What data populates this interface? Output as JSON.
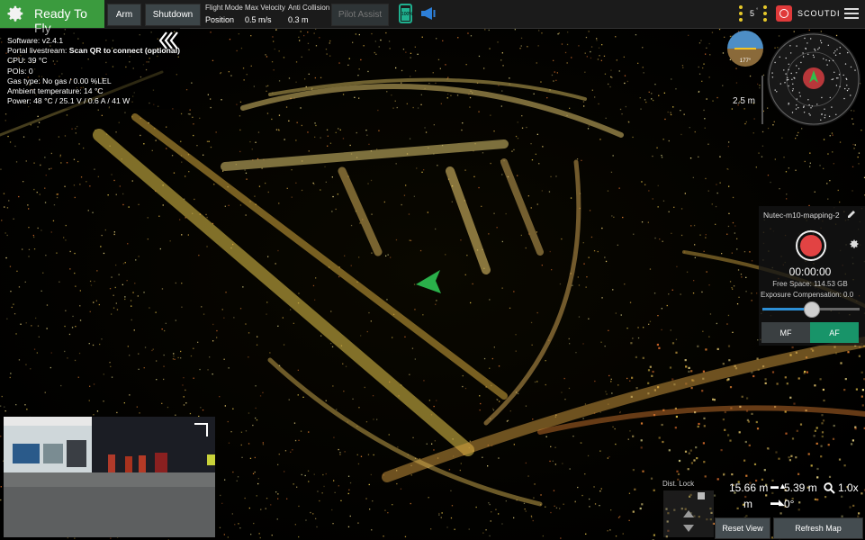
{
  "status": {
    "label": "Ready To Fly",
    "color": "#3b9b3e"
  },
  "toolbar": {
    "arm_label": "Arm",
    "shutdown_label": "Shutdown",
    "flight_mode_label": "Flight Mode",
    "flight_mode_value": "Position",
    "max_velocity_label": "Max Velocity",
    "max_velocity_value": "0.5 m/s",
    "anti_collision_label": "Anti Collision",
    "anti_collision_value": "0.3 m",
    "pilot_assist_label": "Pilot Assist",
    "battery_text": "100%",
    "satellites": "5",
    "brand": "SCOUTDI"
  },
  "telemetry": {
    "software": "Software: v2.4.1",
    "portal_label": "Portal livestream:",
    "portal_value": "Scan QR to connect (optional)",
    "cpu": "CPU: 39 °C",
    "pois": "POIs: 0",
    "gas": "Gas type: No gas / 0.00 %LEL",
    "ambient": "Ambient temperature: 14 °C",
    "power": "Power: 48 °C / 25.1 V / 0.6 A / 41 W"
  },
  "navigation": {
    "heading": "177°",
    "altitude": "2.5 m"
  },
  "recorder": {
    "session_name": "Nutec-m10-mapping-2",
    "timer": "00:00:00",
    "free_space": "Free Space: 114.53 GB",
    "exposure_label": "Exposure Compensation: 0.0",
    "exposure_fraction": 0.5,
    "mf_label": "MF",
    "af_label": "AF"
  },
  "stats": {
    "distance": "15.66 m",
    "altitude": "5.39 m",
    "zoom": "1.0x",
    "unit": "m",
    "angle": "0°",
    "dist_lock_label": "Dist. Lock"
  },
  "buttons": {
    "reset_view": "Reset View",
    "refresh_map": "Refresh Map"
  },
  "colors": {
    "accent": "#189469",
    "record": "#e24343",
    "toolbar_bg": "#1b1b1b"
  }
}
